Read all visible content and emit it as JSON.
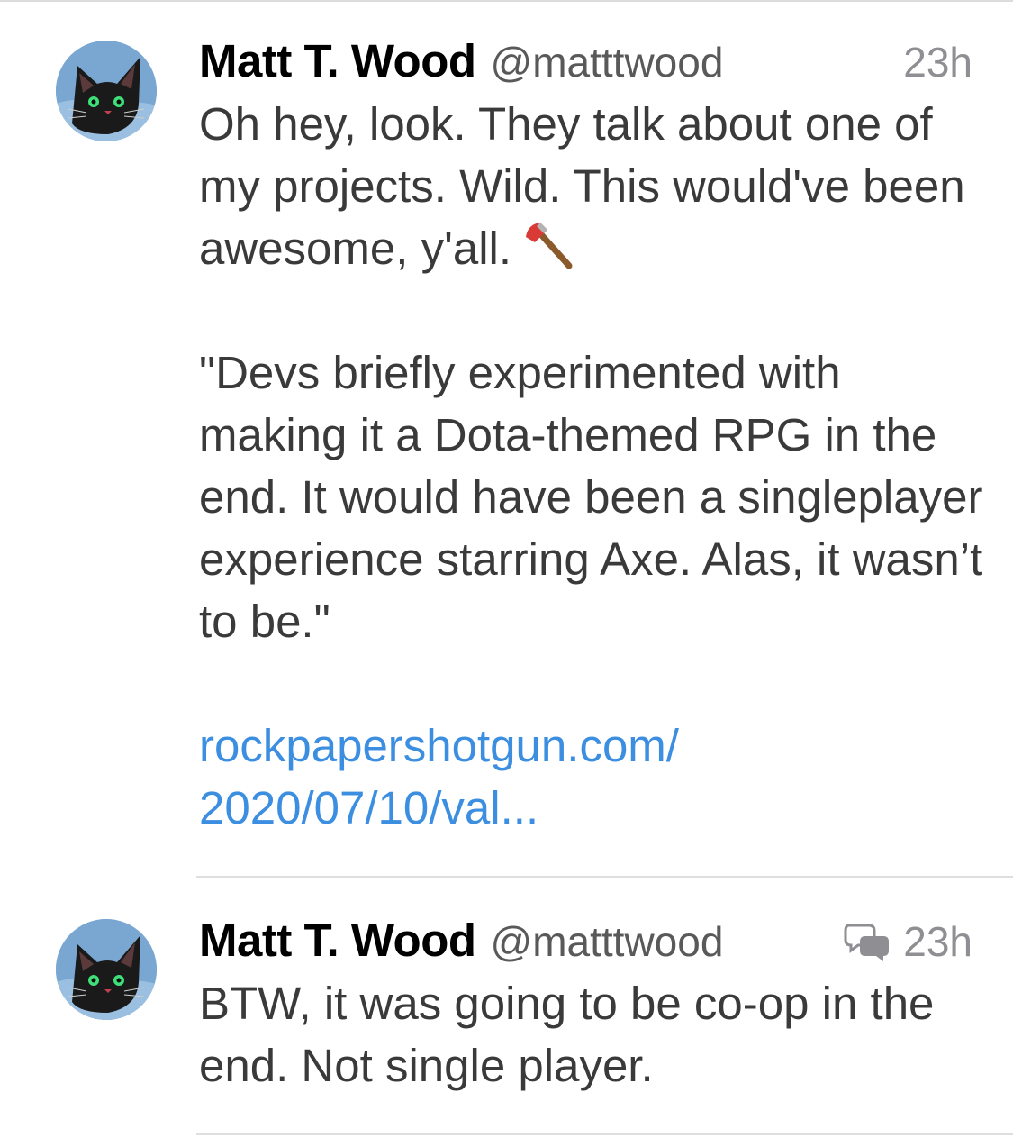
{
  "tweets": [
    {
      "display_name": "Matt T. Wood",
      "handle": "@matttwood",
      "timestamp": "23h",
      "avatar_icon": "black-cat-avatar",
      "text_1": "Oh hey, look. They talk about one of my projects. Wild. This would've been awesome, y'all.",
      "emoji": "axe-emoji",
      "text_2": "\"Devs briefly experimented with making it a Dota-themed RPG in the end. It would have been a singleplayer experience starring Axe. Alas, it wasn’t to be.\"",
      "link": "rockpapershotgun.com/ 2020/07/10/val..."
    },
    {
      "display_name": "Matt T. Wood",
      "handle": "@matttwood",
      "timestamp": "23h",
      "avatar_icon": "black-cat-avatar",
      "conversation_icon": "conversation-icon",
      "text_1": "BTW, it was going to be co-op in the end. Not single player."
    }
  ],
  "colors": {
    "name": "#000000",
    "body_text": "#3a3a3a",
    "handle": "#595959",
    "timestamp": "#8e8e93",
    "link": "#3b8ee0",
    "divider": "#dedede"
  }
}
